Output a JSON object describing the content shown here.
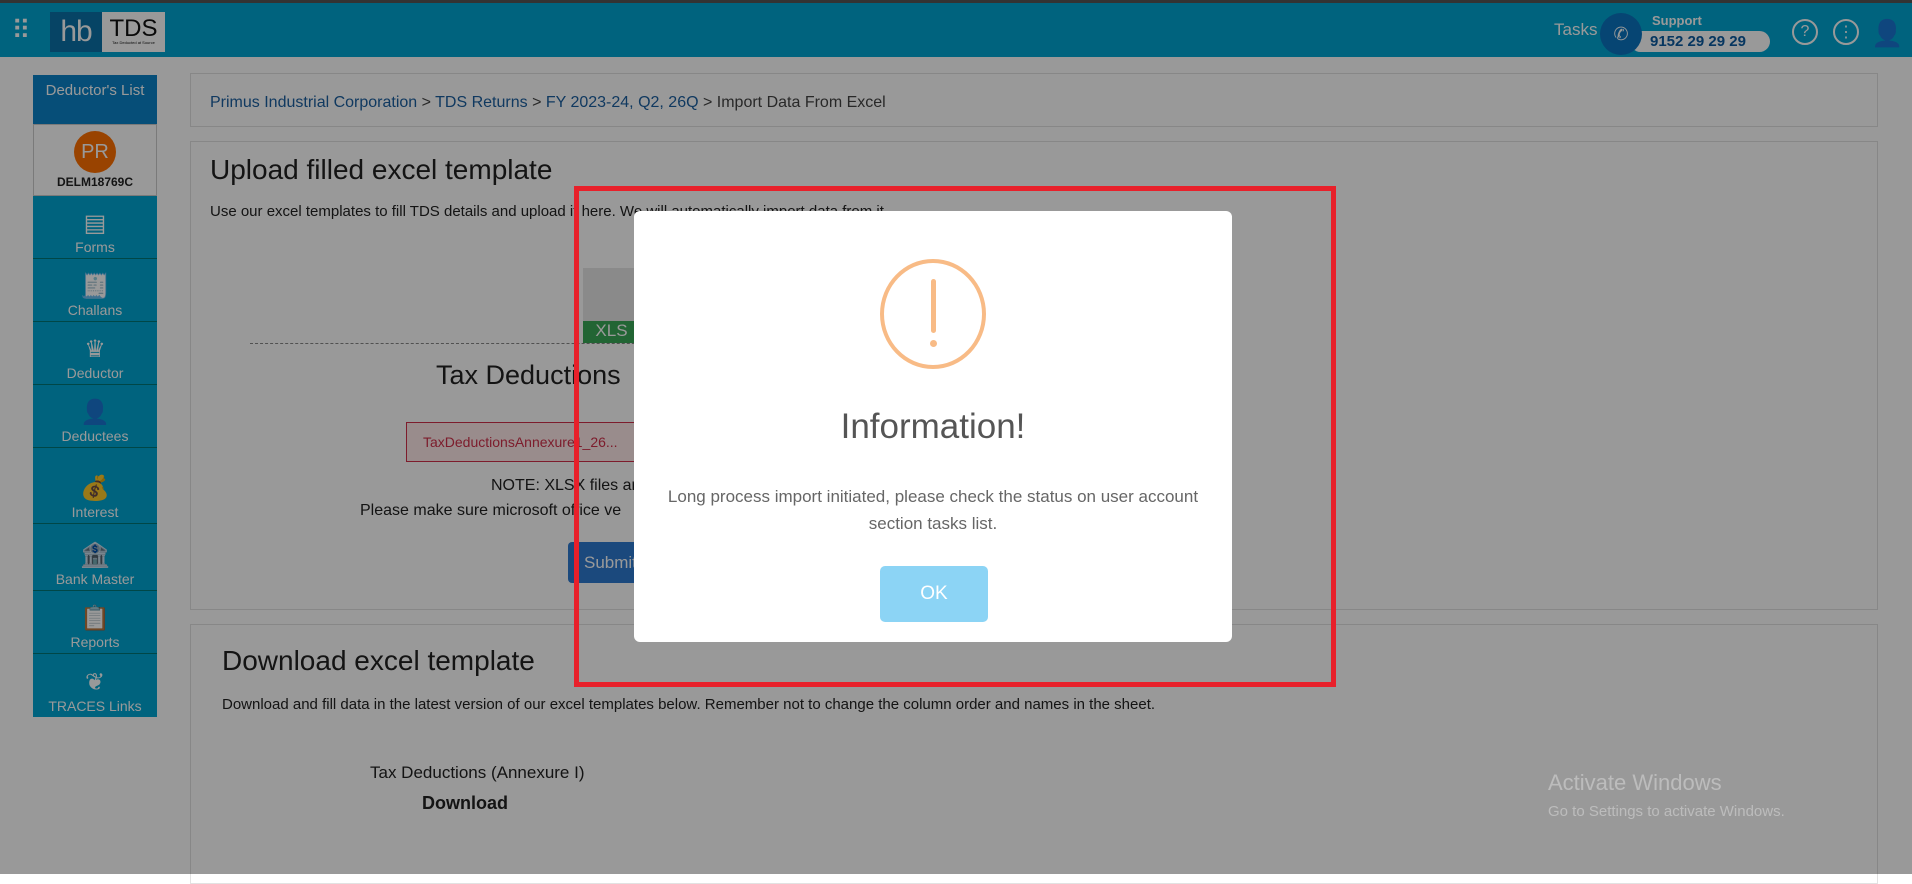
{
  "header": {
    "logo_hb": "hb",
    "logo_tds": "TDS",
    "logo_tagline": "Tax Deducted at Source",
    "tasks": "Tasks",
    "support_label": "Support",
    "support_phone": "9152 29 29 29",
    "icons": [
      "apps-grid-icon",
      "phone-icon",
      "help-icon",
      "more-options-icon",
      "user-icon"
    ]
  },
  "sidebar": {
    "header": "Deductor's List",
    "avatar_initials": "PR",
    "deductor_code": "DELM18769C",
    "items": [
      {
        "label": "Forms",
        "icon": "▤"
      },
      {
        "label": "Challans",
        "icon": "🧾"
      },
      {
        "label": "Deductor",
        "icon": "♛"
      },
      {
        "label": "Deductees",
        "icon": "👤"
      },
      {
        "label": "Interest",
        "icon": "💰"
      },
      {
        "label": "Bank Master",
        "icon": "🏦"
      },
      {
        "label": "Reports",
        "icon": "📋"
      },
      {
        "label": "TRACES Links",
        "icon": "❦"
      }
    ]
  },
  "breadcrumb": {
    "items": [
      "Primus Industrial Corporation",
      "TDS Returns",
      "FY 2023-24, Q2, 26Q"
    ],
    "current": "Import Data From Excel",
    "sep": " > "
  },
  "upload": {
    "title": "Upload filled excel template",
    "subtitle": "Use our excel templates to fill TDS details and upload it here. We will automatically import data from it.",
    "file_icon_label": "XLS",
    "template_name": "Tax Deductions",
    "file_name": "TaxDeductionsAnnexure1_26...",
    "note1": "NOTE: XLSX files ar",
    "note2": "Please make sure microsoft office ve",
    "submit": "Submit"
  },
  "download": {
    "title": "Download excel template",
    "description": "Download and fill data in the latest version of our excel templates below. Remember not to change the column order and names in the sheet.",
    "template_name": "Tax Deductions (Annexure I)",
    "download_label": "Download"
  },
  "watermark": {
    "line1": "Activate Windows",
    "line2": "Go to Settings to activate Windows."
  },
  "modal": {
    "icon": "warning-icon",
    "title": "Information!",
    "message": "Long process import initiated, please check the status on user account section tasks list.",
    "ok": "OK",
    "icon_color": "#f8bb86",
    "button_color": "#8cd4f5"
  },
  "annotation": {
    "highlight_color": "#e8202a"
  }
}
